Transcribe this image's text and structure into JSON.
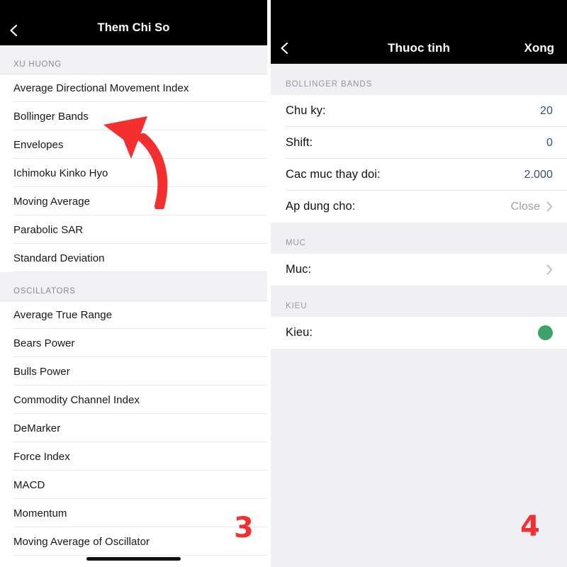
{
  "left_screen": {
    "nav": {
      "back_icon": "chevron-left-icon",
      "title": "Them Chi So"
    },
    "sections": [
      {
        "header": "XU HUONG",
        "items": [
          "Average Directional Movement Index",
          "Bollinger Bands",
          "Envelopes",
          "Ichimoku Kinko Hyo",
          "Moving Average",
          "Parabolic SAR",
          "Standard Deviation"
        ]
      },
      {
        "header": "OSCILLATORS",
        "items": [
          "Average True Range",
          "Bears Power",
          "Bulls Power",
          "Commodity Channel Index",
          "DeMarker",
          "Force Index",
          "MACD",
          "Momentum",
          "Moving Average of Oscillator"
        ]
      }
    ],
    "annotation": {
      "arrow_icon": "curved-arrow-up-left-icon",
      "arrow_target": "Bollinger Bands",
      "step_number": "3",
      "color": "#f32f2f"
    }
  },
  "right_screen": {
    "nav": {
      "back_icon": "chevron-left-icon",
      "title": "Thuoc tinh",
      "action": "Xong"
    },
    "sections": [
      {
        "header": "BOLLINGER BANDS",
        "rows": [
          {
            "label": "Chu ky:",
            "value": "20",
            "value_kind": "number",
            "accessory": "none"
          },
          {
            "label": "Shift:",
            "value": "0",
            "value_kind": "number",
            "accessory": "none"
          },
          {
            "label": "Cac muc thay doi:",
            "value": "2.000",
            "value_kind": "number",
            "accessory": "none"
          },
          {
            "label": "Ap dung cho:",
            "value": "Close",
            "value_kind": "muted",
            "accessory": "chevron-right-icon"
          }
        ]
      },
      {
        "header": "MUC",
        "rows": [
          {
            "label": "Muc:",
            "value": "",
            "value_kind": "muted",
            "accessory": "chevron-right-icon"
          }
        ]
      },
      {
        "header": "KIEU",
        "rows": [
          {
            "label": "Kieu:",
            "value": "",
            "value_kind": "muted",
            "accessory": "color-swatch-green"
          }
        ]
      }
    ],
    "annotation": {
      "step_number": "4",
      "color": "#f32f2f"
    },
    "colors": {
      "value_blue": "#2e5274",
      "swatch_green": "#3ca468"
    }
  }
}
